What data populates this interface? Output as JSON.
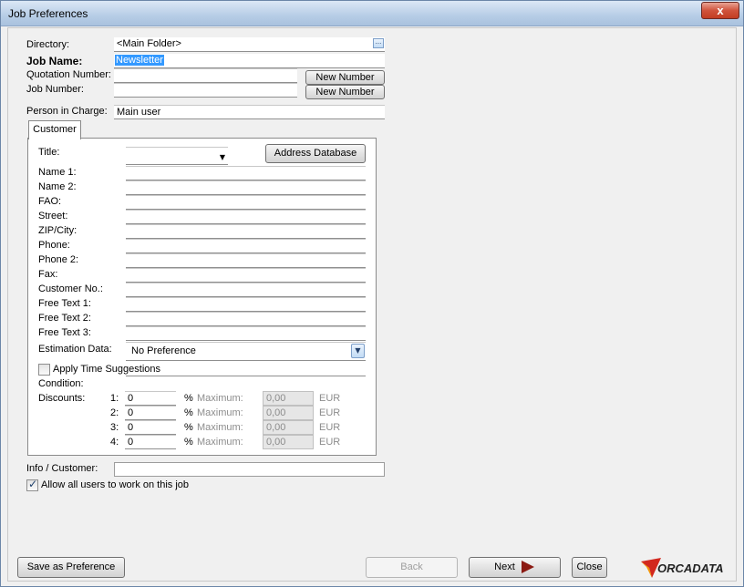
{
  "window": {
    "title": "Job Preferences",
    "close_glyph": "x"
  },
  "header": {
    "directory_label": "Directory:",
    "directory_value": "<Main Folder>",
    "directory_button": "...",
    "job_name_label": "Job Name:",
    "job_name_value": "Newsletter",
    "quotation_label": "Quotation Number:",
    "quotation_value": "",
    "quotation_button": "New Number",
    "job_number_label": "Job Number:",
    "job_number_value": "",
    "job_number_button": "New Number",
    "person_label": "Person in Charge:",
    "person_value": "Main user"
  },
  "tabs": [
    {
      "label": "Customer",
      "active": true
    }
  ],
  "customer": {
    "title_label": "Title:",
    "title_value": "",
    "address_button": "Address Database",
    "fields": [
      {
        "label": "Name 1:",
        "value": ""
      },
      {
        "label": "Name 2:",
        "value": ""
      },
      {
        "label": "FAO:",
        "value": ""
      },
      {
        "label": "Street:",
        "value": ""
      },
      {
        "label": "ZIP/City:",
        "value": ""
      },
      {
        "label": "Phone:",
        "value": ""
      },
      {
        "label": "Phone 2:",
        "value": ""
      },
      {
        "label": "Fax:",
        "value": ""
      },
      {
        "label": "Customer No.:",
        "value": ""
      },
      {
        "label": "Free Text 1:",
        "value": ""
      },
      {
        "label": "Free Text 2:",
        "value": ""
      },
      {
        "label": "Free Text 3:",
        "value": ""
      }
    ],
    "estimation_label": "Estimation Data:",
    "estimation_value": "No Preference",
    "apply_time_label": "Apply Time Suggestions",
    "apply_time_checked": false,
    "condition_label": "Condition:",
    "discounts_label": "Discounts:",
    "discounts": [
      {
        "index": "1:",
        "value": "0",
        "pct": "%",
        "max_label": "Maximum:",
        "max_value": "0,00",
        "currency": "EUR"
      },
      {
        "index": "2:",
        "value": "0",
        "pct": "%",
        "max_label": "Maximum:",
        "max_value": "0,00",
        "currency": "EUR"
      },
      {
        "index": "3:",
        "value": "0",
        "pct": "%",
        "max_label": "Maximum:",
        "max_value": "0,00",
        "currency": "EUR"
      },
      {
        "index": "4:",
        "value": "0",
        "pct": "%",
        "max_label": "Maximum:",
        "max_value": "0,00",
        "currency": "EUR"
      }
    ]
  },
  "footer": {
    "info_label": "Info / Customer:",
    "info_value": "",
    "allow_users_label": "Allow all users to work on this job",
    "allow_users_checked": true,
    "save_pref_button": "Save as Preference",
    "back_button": "Back",
    "next_button": "Next",
    "close_button": "Close",
    "logo_text": "ORCADATA",
    "colors": {
      "logo_red": "#d2281e",
      "logo_orange": "#f39200",
      "next_arrow": "#8b1a12"
    }
  }
}
